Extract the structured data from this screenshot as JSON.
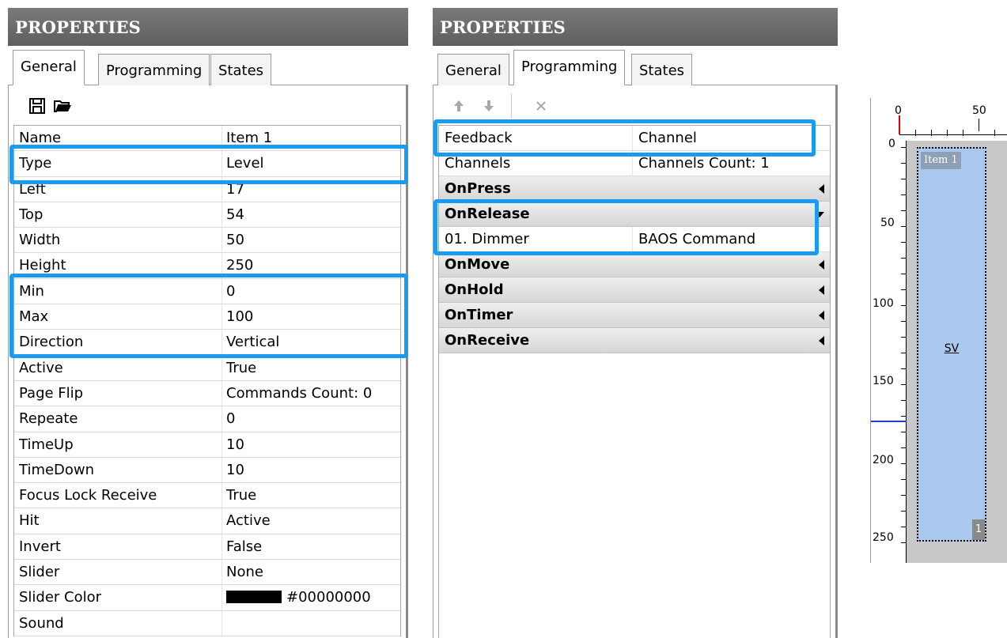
{
  "left_panel": {
    "title": "PROPERTIES",
    "tabs": [
      "General",
      "Programming",
      "States"
    ],
    "active_tab": "General",
    "toolbar": {
      "save_icon": "save-icon",
      "open_icon": "folder-open-icon"
    },
    "rows": [
      {
        "name": "Name",
        "value": "Item 1"
      },
      {
        "name": "Type",
        "value": "Level"
      },
      {
        "name": "Left",
        "value": "17"
      },
      {
        "name": "Top",
        "value": "54"
      },
      {
        "name": "Width",
        "value": "50"
      },
      {
        "name": "Height",
        "value": "250"
      },
      {
        "name": "Min",
        "value": "0"
      },
      {
        "name": "Max",
        "value": "100"
      },
      {
        "name": "Direction",
        "value": "Vertical"
      },
      {
        "name": "Active",
        "value": "True"
      },
      {
        "name": "Page Flip",
        "value": "Commands Count: 0"
      },
      {
        "name": "Repeate",
        "value": "0"
      },
      {
        "name": "TimeUp",
        "value": "10"
      },
      {
        "name": "TimeDown",
        "value": "10"
      },
      {
        "name": "Focus Lock Receive",
        "value": "True"
      },
      {
        "name": "Hit",
        "value": "Active"
      },
      {
        "name": "Invert",
        "value": "False"
      },
      {
        "name": "Slider",
        "value": "None"
      },
      {
        "name": "Slider Color",
        "value": "#00000000",
        "swatch_color": "#000000"
      },
      {
        "name": "Sound",
        "value": ""
      }
    ]
  },
  "right_panel": {
    "title": "PROPERTIES",
    "tabs": [
      "General",
      "Programming",
      "States"
    ],
    "active_tab": "Programming",
    "toolbar": {
      "up_icon": "arrow-up-icon",
      "down_icon": "arrow-down-icon",
      "delete_icon": "close-icon"
    },
    "rows": {
      "feedback": {
        "name": "Feedback",
        "value": "Channel"
      },
      "channels": {
        "name": "Channels",
        "value": "Channels Count: 1"
      },
      "on_press": "OnPress",
      "on_release": "OnRelease",
      "dimmer": {
        "name": "01. Dimmer",
        "value": "BAOS Command"
      },
      "on_move": "OnMove",
      "on_hold": "OnHold",
      "on_timer": "OnTimer",
      "on_receive": "OnReceive"
    }
  },
  "canvas": {
    "ruler_top": [
      "0",
      "50"
    ],
    "ruler_left": [
      "0",
      "50",
      "100",
      "150",
      "200",
      "250"
    ],
    "item_label": "Item 1",
    "item_variable": "SV",
    "item_number": "1"
  },
  "highlight_color": "#1a9bf0"
}
